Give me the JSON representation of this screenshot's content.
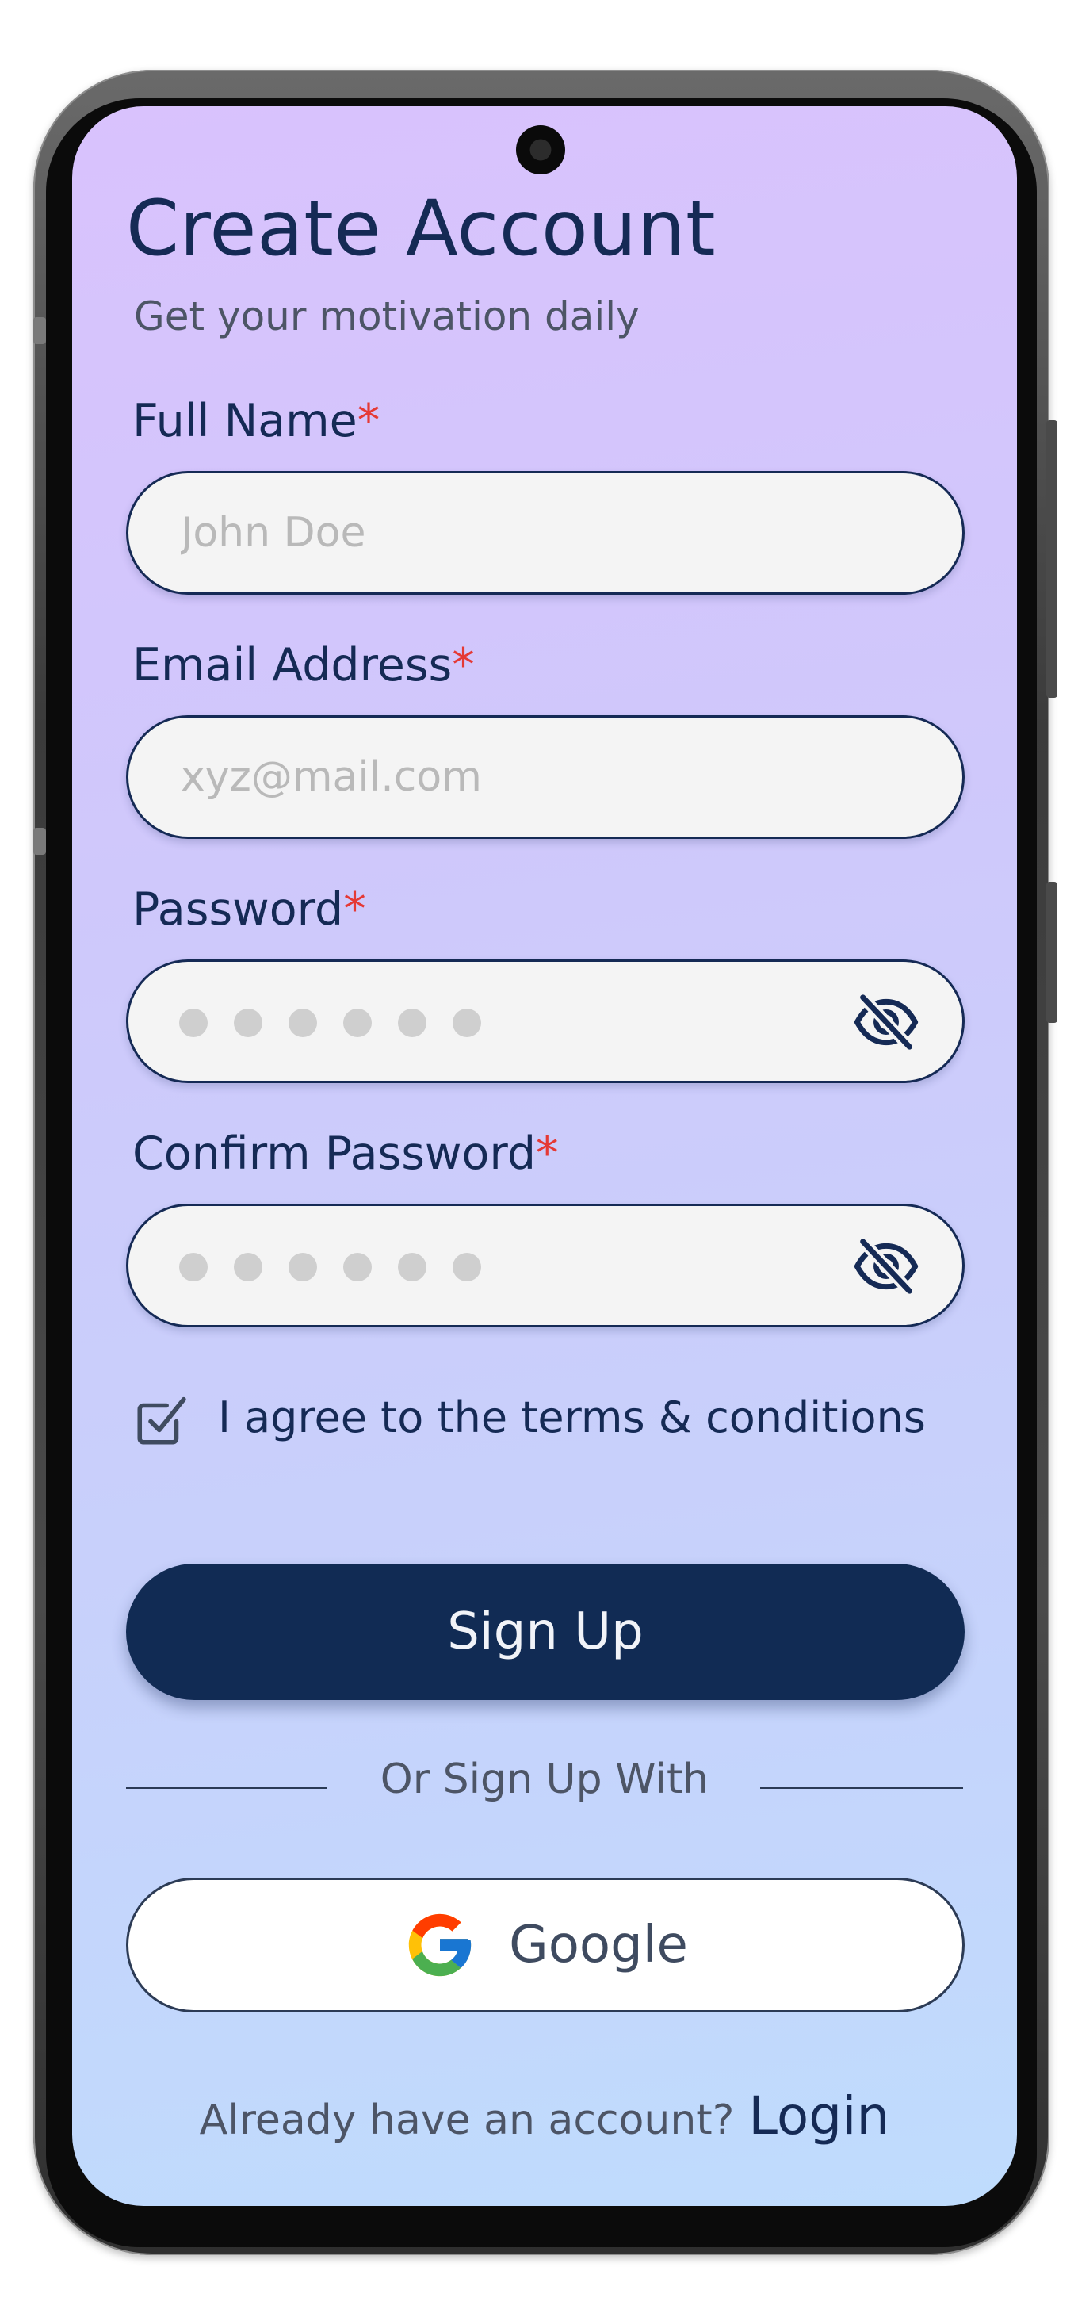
{
  "app": {
    "title": "Create Account",
    "subtitle": "Get your motivation daily"
  },
  "form": {
    "required_marker": "*",
    "full_name": {
      "label": "Full Name",
      "placeholder": "John Doe",
      "value": ""
    },
    "email": {
      "label": "Email Address",
      "placeholder": "xyz@mail.com",
      "value": ""
    },
    "password": {
      "label": "Password",
      "masked_length": 6,
      "visibility": "hidden",
      "toggle_icon": "eye-off-icon"
    },
    "confirm_password": {
      "label": "Confirm Password",
      "masked_length": 6,
      "visibility": "hidden",
      "toggle_icon": "eye-off-icon"
    },
    "terms": {
      "label": "I agree to the terms & conditions",
      "checked": true
    }
  },
  "actions": {
    "signup_label": "Sign Up",
    "divider_text": "Or Sign Up With",
    "google_label": "Google",
    "login_prompt": "Already have an account?",
    "login_link": "Login"
  },
  "colors": {
    "primary": "#112b54",
    "text_dark": "#152a55",
    "text_muted": "#4d5566",
    "required": "#e53935",
    "input_bg": "#f4f4f4",
    "placeholder": "#b9b9b9",
    "gradient_top": "#d9c2fd",
    "gradient_bottom": "#bfdcfd"
  }
}
